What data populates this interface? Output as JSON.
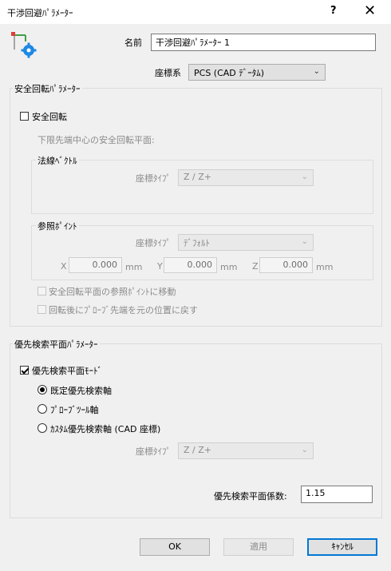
{
  "window": {
    "title": "干渉回避ﾊﾟﾗﾒｰﾀｰ",
    "help": "?",
    "close": "✕"
  },
  "header": {
    "name_label": "名前",
    "name_value": "干渉回避ﾊﾟﾗﾒｰﾀｰ 1",
    "coord_label": "座標系",
    "coord_value": "PCS (CAD ﾃﾞｰﾀﾑ)"
  },
  "safe_group": {
    "title": "安全回転ﾊﾟﾗﾒｰﾀｰ",
    "checkbox_label": "安全回転",
    "subtitle": "下限先端中心の安全回転平面:",
    "normal": {
      "title": "法線ﾍﾞｸﾄﾙ",
      "coord_type_label": "座標ﾀｲﾌﾟ",
      "coord_type_value": "Z / Z+"
    },
    "ref_point": {
      "title": "参照ﾎﾟｲﾝﾄ",
      "coord_type_label": "座標ﾀｲﾌﾟ",
      "coord_type_value": "ﾃﾞﾌｫﾙﾄ",
      "x_label": "X",
      "x_value": "0.000",
      "y_label": "Y",
      "y_value": "0.000",
      "z_label": "Z",
      "z_value": "0.000",
      "unit": "mm"
    },
    "move_option": "安全回転平面の参照ﾎﾟｲﾝﾄに移動",
    "return_option": "回転後にﾌﾟﾛｰﾌﾞ先端を元の位置に戻す"
  },
  "priority_group": {
    "title": "優先検索平面ﾊﾟﾗﾒｰﾀｰ",
    "mode_label": "優先検索平面ﾓｰﾄﾞ",
    "radio_default": "既定優先検索軸",
    "radio_probe": "ﾌﾟﾛｰﾌﾞﾂｰﾙ軸",
    "radio_custom": "ｶｽﾀﾑ優先検索軸 (CAD 座標)",
    "coord_type_label": "座標ﾀｲﾌﾟ",
    "coord_type_value": "Z / Z+",
    "factor_label": "優先検索平面係数:",
    "factor_value": "1.15"
  },
  "buttons": {
    "ok": "OK",
    "apply": "適用",
    "cancel": "ｷｬﾝｾﾙ"
  },
  "colors": {
    "accent": "#0078d7",
    "icon_blue": "#1e88e5",
    "icon_red": "#e53935",
    "icon_green": "#43a047"
  }
}
